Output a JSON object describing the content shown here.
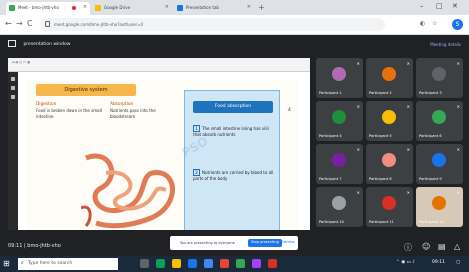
{
  "browser": {
    "tabs": [
      {
        "label": "Meet - bmo-jhtb-vho"
      },
      {
        "label": "Google Drive"
      },
      {
        "label": "Presentation tab"
      }
    ],
    "new_tab_glyph": "+",
    "url": "meet.google.com/bmo-jhtb-vho?authuser=0",
    "profile_initial": "S"
  },
  "meet": {
    "header_title": "presentation window",
    "header_link": "Meeting details",
    "time_code": "09:11 | bmo-jhtb-vho",
    "toast_text": "You are presenting to everyone",
    "toast_primary": "Stop presenting",
    "toast_secondary": "Dismiss",
    "participants": [
      {
        "name": "Participant 1",
        "color": "#b06ab3"
      },
      {
        "name": "Participant 2",
        "color": "#e8710a"
      },
      {
        "name": "Participant 3",
        "color": "#5f6368"
      },
      {
        "name": "Participant 4",
        "color": "#1e8e3e"
      },
      {
        "name": "Participant 5",
        "color": "#fbbc04"
      },
      {
        "name": "Participant 6",
        "color": "#34a853"
      },
      {
        "name": "Participant 7",
        "color": "#7b1fa2"
      },
      {
        "name": "Participant 8",
        "color": "#f28b82"
      },
      {
        "name": "Participant 9",
        "color": "#1a73e8"
      },
      {
        "name": "Participant 10",
        "color": "#9aa0a6"
      },
      {
        "name": "Participant 11",
        "color": "#d93025"
      },
      {
        "name": "Participant 12",
        "color": "#e37400"
      }
    ]
  },
  "slide": {
    "title": "Digestive system",
    "col1_head": "Digestion",
    "col1_text": "Food is broken down in the small intestine",
    "col2_head": "Absorption",
    "col2_text": "Nutrients pass into the bloodstream",
    "info_title": "Food absorption",
    "info1": "The small intestine lining has villi that absorb nutrients",
    "info2": "Nutrients are carried by blood to all parts of the body",
    "page_indicator": "4",
    "watermark": "PSO"
  },
  "taskbar": {
    "search_placeholder": "Type here to search",
    "clock": "09:11"
  }
}
